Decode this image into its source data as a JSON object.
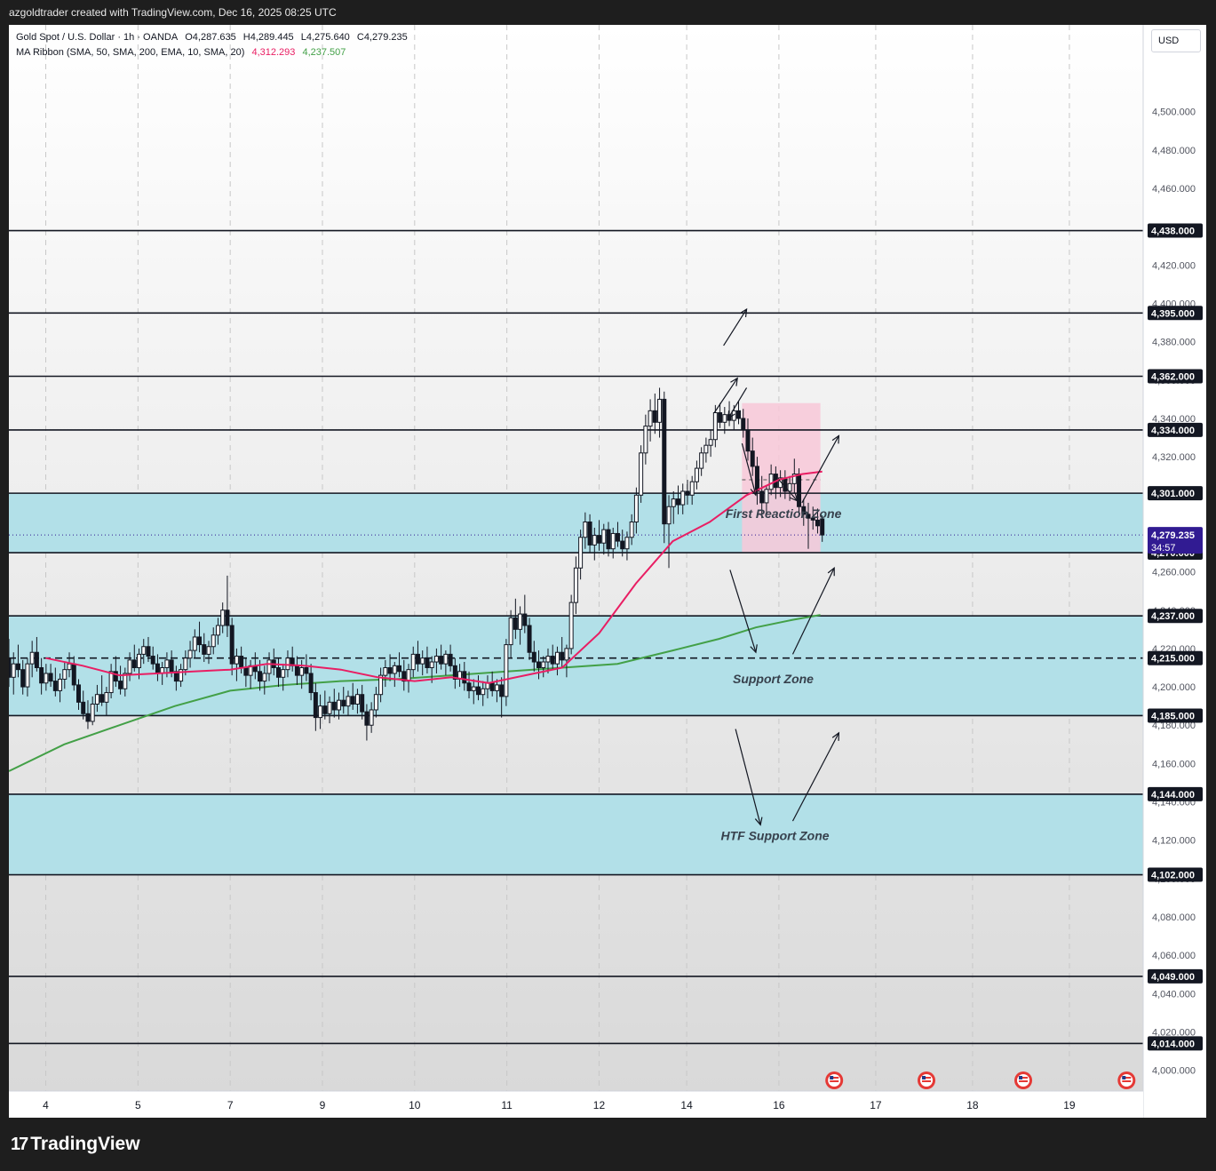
{
  "header": {
    "caption": "azgoldtrader created with TradingView.com, Dec 16, 2025 08:25 UTC"
  },
  "legend": {
    "symbol": "Gold Spot / U.S. Dollar · 1h · OANDA",
    "open": "O4,287.635",
    "high": "H4,289.445",
    "low": "L4,275.640",
    "close": "C4,279.235",
    "indicator": "MA Ribbon (SMA, 50, SMA, 200, EMA, 10, SMA, 20)",
    "ma_fast_value": "4,312.293",
    "ma_slow_value": "4,237.507"
  },
  "currency": "USD",
  "brand": {
    "logo": "17",
    "name": "TradingView"
  },
  "colors": {
    "up_candle": "#131722",
    "down_candle": "#131722",
    "ma_fast": "#e91e63",
    "ma_slow": "#43a047",
    "zone_fill": "#b2e0e8",
    "reaction_box": "#f8c8d8",
    "price_badge": "#311b92",
    "level_badge": "#131722"
  },
  "chart_data": {
    "type": "candlestick",
    "ylim": [
      3985,
      4530
    ],
    "price_ticks": [
      4000,
      4020,
      4040,
      4060,
      4080,
      4100,
      4120,
      4140,
      4160,
      4180,
      4200,
      4220,
      4240,
      4260,
      4280,
      4300,
      4320,
      4340,
      4360,
      4380,
      4400,
      4420,
      4440,
      4460,
      4480,
      4500
    ],
    "date_labels": [
      {
        "label": "4",
        "t": 4.0
      },
      {
        "label": "5",
        "t": 5.0
      },
      {
        "label": "7",
        "t": 6.0
      },
      {
        "label": "9",
        "t": 7.0
      },
      {
        "label": "10",
        "t": 8.0
      },
      {
        "label": "11",
        "t": 9.0
      },
      {
        "label": "12",
        "t": 10.0
      },
      {
        "label": "14",
        "t": 10.95
      },
      {
        "label": "16",
        "t": 11.95
      },
      {
        "label": "17",
        "t": 13.0
      },
      {
        "label": "18",
        "t": 14.05
      },
      {
        "label": "19",
        "t": 15.1
      }
    ],
    "t_range": [
      3.6,
      15.9
    ],
    "levels": [
      {
        "price": 4438,
        "label": "4,438.000"
      },
      {
        "price": 4395,
        "label": "4,395.000"
      },
      {
        "price": 4362,
        "label": "4,362.000"
      },
      {
        "price": 4334,
        "label": "4,334.000"
      },
      {
        "price": 4301,
        "label": "4,301.000"
      },
      {
        "price": 4270,
        "label": "4,270.000"
      },
      {
        "price": 4237,
        "label": "4,237.000"
      },
      {
        "price": 4215,
        "label": "4,215.000",
        "dashed": true
      },
      {
        "price": 4185,
        "label": "4,185.000"
      },
      {
        "price": 4144,
        "label": "4,144.000"
      },
      {
        "price": 4102,
        "label": "4,102.000"
      },
      {
        "price": 4049,
        "label": "4,049.000"
      },
      {
        "price": 4014,
        "label": "4,014.000"
      }
    ],
    "zones": [
      {
        "from": 4270,
        "to": 4301,
        "label": "First Reaction Zone"
      },
      {
        "from": 4185,
        "to": 4237,
        "label": "Support Zone"
      },
      {
        "from": 4102,
        "to": 4144,
        "label": "HTF Support Zone"
      }
    ],
    "reaction_box": {
      "t_from": 11.55,
      "t_to": 12.4,
      "low": 4270,
      "high": 4348
    },
    "last_price": {
      "value": 4279.235,
      "label": "4,279.235",
      "countdown": "34:57"
    },
    "candles": [
      [
        4215,
        4225,
        4200,
        4205
      ],
      [
        4205,
        4218,
        4196,
        4212
      ],
      [
        4212,
        4222,
        4205,
        4209
      ],
      [
        4209,
        4214,
        4196,
        4200
      ],
      [
        4200,
        4215,
        4195,
        4212
      ],
      [
        4212,
        4224,
        4205,
        4218
      ],
      [
        4218,
        4226,
        4208,
        4210
      ],
      [
        4210,
        4215,
        4196,
        4202
      ],
      [
        4202,
        4212,
        4198,
        4207
      ],
      [
        4207,
        4212,
        4200,
        4203
      ],
      [
        4203,
        4210,
        4195,
        4198
      ],
      [
        4198,
        4207,
        4192,
        4204
      ],
      [
        4204,
        4213,
        4199,
        4209
      ],
      [
        4209,
        4218,
        4205,
        4212
      ],
      [
        4212,
        4216,
        4198,
        4201
      ],
      [
        4201,
        4204,
        4188,
        4192
      ],
      [
        4192,
        4198,
        4183,
        4186
      ],
      [
        4186,
        4193,
        4178,
        4182
      ],
      [
        4182,
        4195,
        4180,
        4191
      ],
      [
        4191,
        4201,
        4187,
        4196
      ],
      [
        4196,
        4206,
        4190,
        4192
      ],
      [
        4192,
        4200,
        4185,
        4197
      ],
      [
        4197,
        4212,
        4194,
        4208
      ],
      [
        4208,
        4216,
        4200,
        4203
      ],
      [
        4203,
        4211,
        4196,
        4199
      ],
      [
        4199,
        4210,
        4195,
        4207
      ],
      [
        4207,
        4218,
        4203,
        4214
      ],
      [
        4214,
        4222,
        4208,
        4210
      ],
      [
        4210,
        4220,
        4204,
        4217
      ],
      [
        4217,
        4225,
        4212,
        4221
      ],
      [
        4221,
        4226,
        4213,
        4216
      ],
      [
        4216,
        4221,
        4209,
        4212
      ],
      [
        4212,
        4217,
        4203,
        4207
      ],
      [
        4207,
        4213,
        4201,
        4210
      ],
      [
        4210,
        4218,
        4205,
        4214
      ],
      [
        4214,
        4219,
        4205,
        4208
      ],
      [
        4208,
        4211,
        4198,
        4203
      ],
      [
        4203,
        4212,
        4200,
        4209
      ],
      [
        4209,
        4219,
        4206,
        4215
      ],
      [
        4215,
        4224,
        4210,
        4219
      ],
      [
        4219,
        4230,
        4215,
        4226
      ],
      [
        4226,
        4234,
        4218,
        4222
      ],
      [
        4222,
        4228,
        4213,
        4217
      ],
      [
        4217,
        4224,
        4212,
        4221
      ],
      [
        4221,
        4231,
        4217,
        4227
      ],
      [
        4227,
        4236,
        4222,
        4232
      ],
      [
        4232,
        4244,
        4228,
        4240
      ],
      [
        4240,
        4258,
        4226,
        4232
      ],
      [
        4232,
        4236,
        4206,
        4212
      ],
      [
        4212,
        4220,
        4203,
        4216
      ],
      [
        4216,
        4221,
        4207,
        4210
      ],
      [
        4210,
        4215,
        4200,
        4206
      ],
      [
        4206,
        4214,
        4199,
        4211
      ],
      [
        4211,
        4218,
        4204,
        4208
      ],
      [
        4208,
        4214,
        4198,
        4203
      ],
      [
        4203,
        4211,
        4196,
        4207
      ],
      [
        4207,
        4218,
        4203,
        4214
      ],
      [
        4214,
        4220,
        4206,
        4210
      ],
      [
        4210,
        4215,
        4200,
        4205
      ],
      [
        4205,
        4212,
        4198,
        4209
      ],
      [
        4209,
        4219,
        4205,
        4215
      ],
      [
        4215,
        4221,
        4208,
        4211
      ],
      [
        4211,
        4216,
        4201,
        4206
      ],
      [
        4206,
        4214,
        4199,
        4210
      ],
      [
        4210,
        4217,
        4203,
        4207
      ],
      [
        4207,
        4212,
        4193,
        4197
      ],
      [
        4197,
        4202,
        4177,
        4184
      ],
      [
        4184,
        4196,
        4178,
        4190
      ],
      [
        4190,
        4198,
        4183,
        4186
      ],
      [
        4186,
        4195,
        4181,
        4192
      ],
      [
        4192,
        4199,
        4184,
        4188
      ],
      [
        4188,
        4197,
        4183,
        4193
      ],
      [
        4193,
        4200,
        4186,
        4190
      ],
      [
        4190,
        4198,
        4185,
        4195
      ],
      [
        4195,
        4202,
        4188,
        4191
      ],
      [
        4191,
        4199,
        4186,
        4196
      ],
      [
        4196,
        4201,
        4183,
        4187
      ],
      [
        4187,
        4191,
        4172,
        4180
      ],
      [
        4180,
        4192,
        4176,
        4188
      ],
      [
        4188,
        4200,
        4184,
        4196
      ],
      [
        4196,
        4210,
        4192,
        4206
      ],
      [
        4206,
        4214,
        4200,
        4210
      ],
      [
        4210,
        4217,
        4203,
        4207
      ],
      [
        4207,
        4213,
        4200,
        4211
      ],
      [
        4211,
        4218,
        4205,
        4208
      ],
      [
        4208,
        4214,
        4198,
        4203
      ],
      [
        4203,
        4212,
        4197,
        4209
      ],
      [
        4209,
        4221,
        4205,
        4217
      ],
      [
        4217,
        4224,
        4208,
        4212
      ],
      [
        4212,
        4219,
        4206,
        4215
      ],
      [
        4215,
        4221,
        4207,
        4210
      ],
      [
        4210,
        4216,
        4202,
        4213
      ],
      [
        4213,
        4220,
        4207,
        4216
      ],
      [
        4216,
        4222,
        4209,
        4212
      ],
      [
        4212,
        4219,
        4206,
        4217
      ],
      [
        4217,
        4222,
        4208,
        4211
      ],
      [
        4211,
        4215,
        4199,
        4204
      ],
      [
        4204,
        4212,
        4200,
        4208
      ],
      [
        4208,
        4213,
        4198,
        4202
      ],
      [
        4202,
        4208,
        4194,
        4198
      ],
      [
        4198,
        4204,
        4191,
        4200
      ],
      [
        4200,
        4206,
        4193,
        4196
      ],
      [
        4196,
        4203,
        4190,
        4199
      ],
      [
        4199,
        4206,
        4194,
        4202
      ],
      [
        4202,
        4208,
        4195,
        4198
      ],
      [
        4198,
        4204,
        4192,
        4201
      ],
      [
        4201,
        4205,
        4184,
        4195
      ],
      [
        4195,
        4225,
        4190,
        4222
      ],
      [
        4222,
        4240,
        4215,
        4236
      ],
      [
        4236,
        4246,
        4225,
        4230
      ],
      [
        4230,
        4242,
        4222,
        4238
      ],
      [
        4238,
        4248,
        4228,
        4232
      ],
      [
        4232,
        4236,
        4214,
        4218
      ],
      [
        4218,
        4224,
        4208,
        4213
      ],
      [
        4213,
        4219,
        4204,
        4210
      ],
      [
        4210,
        4216,
        4205,
        4213
      ],
      [
        4213,
        4220,
        4207,
        4216
      ],
      [
        4216,
        4222,
        4209,
        4212
      ],
      [
        4212,
        4221,
        4206,
        4218
      ],
      [
        4218,
        4226,
        4210,
        4214
      ],
      [
        4214,
        4222,
        4205,
        4220
      ],
      [
        4220,
        4248,
        4217,
        4244
      ],
      [
        4244,
        4268,
        4238,
        4262
      ],
      [
        4262,
        4282,
        4256,
        4278
      ],
      [
        4278,
        4291,
        4272,
        4286
      ],
      [
        4286,
        4290,
        4270,
        4274
      ],
      [
        4274,
        4283,
        4266,
        4279
      ],
      [
        4279,
        4287,
        4271,
        4275
      ],
      [
        4275,
        4285,
        4269,
        4282
      ],
      [
        4282,
        4286,
        4268,
        4272
      ],
      [
        4272,
        4283,
        4267,
        4280
      ],
      [
        4280,
        4286,
        4273,
        4276
      ],
      [
        4276,
        4282,
        4268,
        4272
      ],
      [
        4272,
        4281,
        4266,
        4278
      ],
      [
        4278,
        4290,
        4274,
        4286
      ],
      [
        4286,
        4304,
        4280,
        4300
      ],
      [
        4300,
        4326,
        4296,
        4322
      ],
      [
        4322,
        4342,
        4316,
        4336
      ],
      [
        4336,
        4350,
        4328,
        4344
      ],
      [
        4344,
        4353,
        4332,
        4338
      ],
      [
        4338,
        4356,
        4330,
        4350
      ],
      [
        4350,
        4354,
        4275,
        4285
      ],
      [
        4285,
        4300,
        4262,
        4294
      ],
      [
        4294,
        4302,
        4285,
        4298
      ],
      [
        4298,
        4305,
        4290,
        4295
      ],
      [
        4295,
        4306,
        4290,
        4302
      ],
      [
        4302,
        4308,
        4295,
        4300
      ],
      [
        4300,
        4310,
        4295,
        4307
      ],
      [
        4307,
        4318,
        4303,
        4314
      ],
      [
        4314,
        4325,
        4310,
        4322
      ],
      [
        4322,
        4330,
        4317,
        4326
      ],
      [
        4326,
        4334,
        4320,
        4329
      ],
      [
        4329,
        4347,
        4325,
        4343
      ],
      [
        4343,
        4348,
        4335,
        4338
      ],
      [
        4338,
        4346,
        4332,
        4342
      ],
      [
        4342,
        4349,
        4336,
        4339
      ],
      [
        4339,
        4347,
        4334,
        4344
      ],
      [
        4344,
        4349,
        4337,
        4340
      ],
      [
        4340,
        4345,
        4330,
        4334
      ],
      [
        4334,
        4340,
        4318,
        4323
      ],
      [
        4323,
        4330,
        4310,
        4315
      ],
      [
        4315,
        4320,
        4295,
        4302
      ],
      [
        4302,
        4310,
        4288,
        4296
      ],
      [
        4296,
        4305,
        4290,
        4303
      ],
      [
        4303,
        4316,
        4300,
        4311
      ],
      [
        4311,
        4315,
        4298,
        4304
      ],
      [
        4304,
        4313,
        4299,
        4309
      ],
      [
        4309,
        4313,
        4298,
        4302
      ],
      [
        4302,
        4310,
        4297,
        4306
      ],
      [
        4306,
        4319,
        4301,
        4311
      ],
      [
        4311,
        4314,
        4290,
        4294
      ],
      [
        4294,
        4298,
        4284,
        4290
      ],
      [
        4290,
        4296,
        4272,
        4288
      ],
      [
        4288,
        4294,
        4282,
        4287
      ],
      [
        4287,
        4293,
        4280,
        4284
      ],
      [
        4287.635,
        4289.445,
        4275.64,
        4279.235
      ]
    ],
    "ma_fast": [
      [
        4.0,
        4215
      ],
      [
        4.4,
        4211
      ],
      [
        4.8,
        4206
      ],
      [
        5.2,
        4207
      ],
      [
        5.6,
        4208
      ],
      [
        6.0,
        4209
      ],
      [
        6.4,
        4212
      ],
      [
        6.8,
        4211
      ],
      [
        7.2,
        4209
      ],
      [
        7.6,
        4205
      ],
      [
        8.0,
        4203
      ],
      [
        8.4,
        4205
      ],
      [
        8.8,
        4202
      ],
      [
        9.2,
        4206
      ],
      [
        9.6,
        4210
      ],
      [
        10.0,
        4228
      ],
      [
        10.4,
        4254
      ],
      [
        10.8,
        4276
      ],
      [
        11.2,
        4286
      ],
      [
        11.6,
        4300
      ],
      [
        11.95,
        4308
      ],
      [
        12.2,
        4311
      ],
      [
        12.42,
        4312.293
      ]
    ],
    "ma_slow": [
      [
        3.6,
        4156
      ],
      [
        4.2,
        4170
      ],
      [
        4.8,
        4180
      ],
      [
        5.4,
        4190
      ],
      [
        6.0,
        4198
      ],
      [
        6.6,
        4201
      ],
      [
        7.2,
        4203
      ],
      [
        7.8,
        4204
      ],
      [
        8.4,
        4206
      ],
      [
        9.0,
        4208
      ],
      [
        9.6,
        4210
      ],
      [
        10.2,
        4212
      ],
      [
        10.8,
        4219
      ],
      [
        11.3,
        4225
      ],
      [
        11.7,
        4231
      ],
      [
        12.1,
        4235
      ],
      [
        12.4,
        4237.507
      ]
    ]
  }
}
